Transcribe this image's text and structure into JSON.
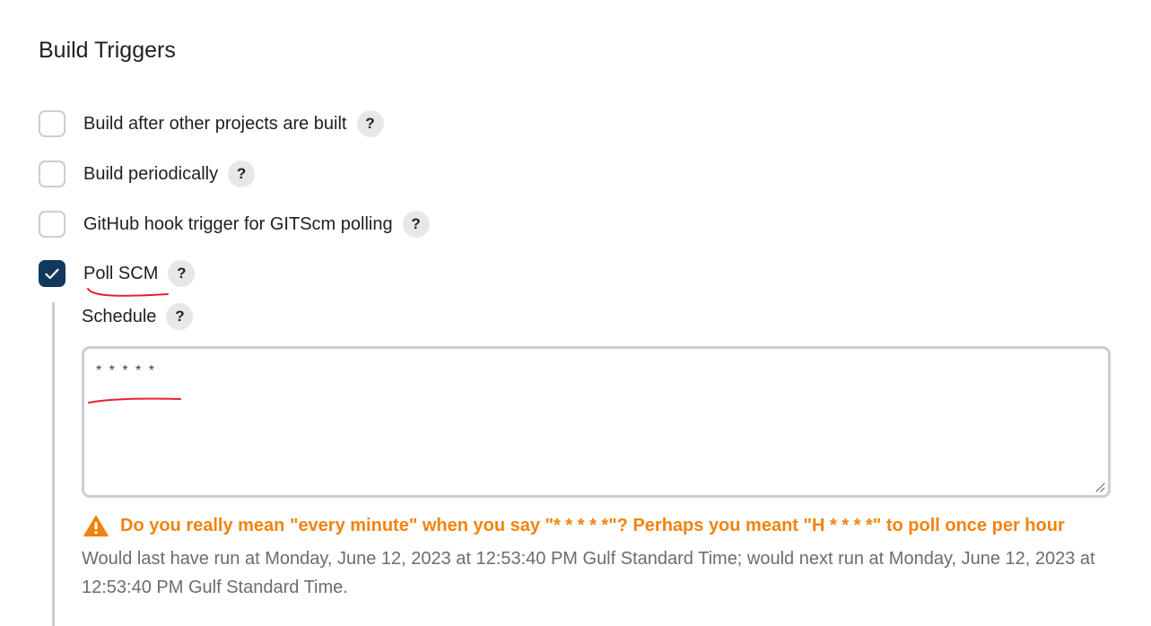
{
  "section": {
    "title": "Build Triggers"
  },
  "triggers": [
    {
      "label": "Build after other projects are built",
      "checked": false,
      "help": "?"
    },
    {
      "label": "Build periodically",
      "checked": false,
      "help": "?"
    },
    {
      "label": "GitHub hook trigger for GITScm polling",
      "checked": false,
      "help": "?"
    },
    {
      "label": "Poll SCM",
      "checked": true,
      "help": "?"
    }
  ],
  "schedule": {
    "label": "Schedule",
    "help": "?",
    "value": "* * * * *"
  },
  "warning": {
    "text": "Do you really mean \"every minute\" when you say \"* * * * *\"? Perhaps you meant \"H * * * *\" to poll once per hour"
  },
  "info": {
    "text": "Would last have run at Monday, June 12, 2023 at 12:53:40 PM Gulf Standard Time; would next run at Monday, June 12, 2023 at 12:53:40 PM Gulf Standard Time."
  },
  "colors": {
    "checked": "#12395b",
    "warning": "#f2830e",
    "annotation": "#e8202a",
    "border": "#c9ced4"
  }
}
